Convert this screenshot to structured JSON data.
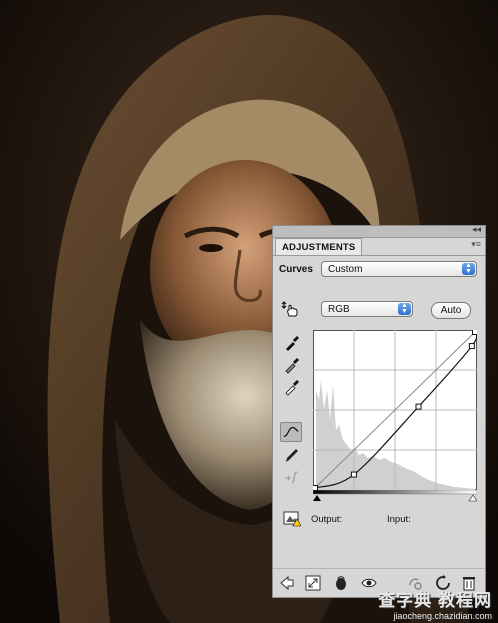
{
  "panel": {
    "tab_label": "ADJUSTMENTS",
    "collapse_glyph": "◂◂",
    "menu_glyph": "▾≡",
    "type_label": "Curves",
    "preset_value": "Custom",
    "channel_value": "RGB",
    "auto_label": "Auto",
    "output_label": "Output:",
    "input_label": "Input:"
  },
  "curve": {
    "points": [
      [
        0,
        0
      ],
      [
        62,
        22
      ],
      [
        165,
        133
      ],
      [
        250,
        232
      ],
      [
        255,
        255
      ]
    ]
  },
  "watermark": {
    "brand": "查字典 教程网",
    "url": "jiaocheng.chazidian.com"
  },
  "colors": {
    "panel_bg": "#d6d6d6",
    "accent": "#2f6fcf"
  },
  "icons": [
    "click-drag-hand-icon",
    "eyedropper-black-icon",
    "eyedropper-gray-icon",
    "eyedropper-white-icon",
    "curve-edit-icon",
    "pencil-icon",
    "smooth-icon",
    "clipping-warning-icon",
    "back-arrow-icon",
    "expand-view-icon",
    "clip-to-layer-icon",
    "visibility-eye-icon",
    "previous-state-icon",
    "reset-icon",
    "trash-icon"
  ]
}
